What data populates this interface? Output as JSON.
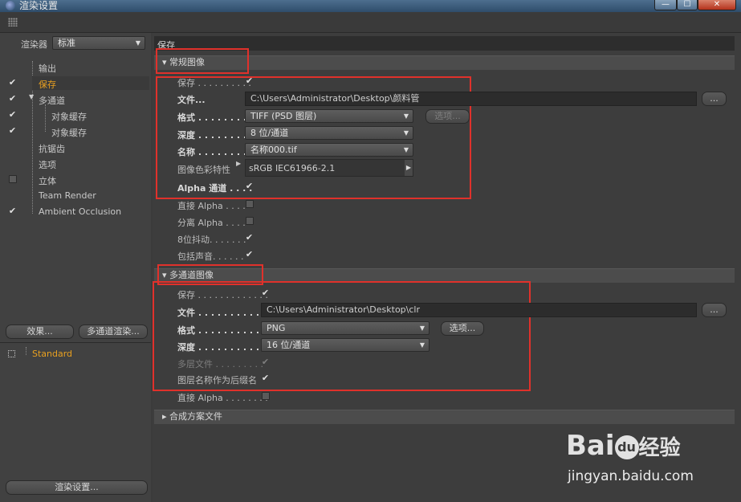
{
  "window": {
    "title": "渲染设置",
    "min": "—",
    "max": "☐",
    "close": "✕"
  },
  "sidebar": {
    "renderer_label": "渲染器",
    "renderer_value": "标准",
    "items": [
      {
        "label": "输出",
        "checked": false
      },
      {
        "label": "保存",
        "checked": true,
        "active": true
      },
      {
        "label": "多通道",
        "checked": true
      },
      {
        "label": "对象缓存",
        "checked": true
      },
      {
        "label": "对象缓存",
        "checked": true
      },
      {
        "label": "抗锯齿",
        "checked": false
      },
      {
        "label": "选项",
        "checked": false
      },
      {
        "label": "立体",
        "checked": false
      },
      {
        "label": "Team Render",
        "checked": false
      },
      {
        "label": "Ambient Occlusion",
        "checked": true
      }
    ],
    "effects_btn": "效果...",
    "multipass_btn": "多通道渲染...",
    "preset": "Standard",
    "render_settings_btn": "渲染设置..."
  },
  "header": {
    "title": "保存"
  },
  "regular": {
    "section_title": "常规图像",
    "save_label": "保存 . . . . . . . . . .",
    "file_label": "文件...",
    "file_value": "C:\\Users\\Administrator\\Desktop\\颜料管",
    "file_btn": "...",
    "format_label": "格式 . . . . . . . . .",
    "format_value": "TIFF (PSD 图层)",
    "options_btn": "选项...",
    "depth_label": "深度 . . . . . . . . .",
    "depth_value": "8 位/通道",
    "name_label": "名称 . . . . . . . . .",
    "name_value": "名称000.tif",
    "profile_label": "图像色彩特性",
    "profile_value": "sRGB IEC61966-2.1",
    "alpha_label": "Alpha 通道 . . . .",
    "straight_alpha_label": "直接 Alpha . . . .",
    "separate_alpha_label": "分离 Alpha . . . .",
    "dither_label": "8位抖动. . . . . . .",
    "sound_label": "包括声音. . . . . ."
  },
  "multipass": {
    "section_title": "多通道图像",
    "save_label": "保存 . . . . . . . . . . . . .",
    "file_label": "文件 . . . . . . . . . . . . .",
    "file_value": "C:\\Users\\Administrator\\Desktop\\clr",
    "file_btn": "...",
    "format_label": "格式 . . . . . . . . . . . . .",
    "format_value": "PNG",
    "options_btn": "选项...",
    "depth_label": "深度 . . . . . . . . . . . . .",
    "depth_value": "16 位/通道",
    "layers_label": "多层文件 . . . . . . . . .",
    "layername_label": "图层名称作为后缀名",
    "straight_alpha_label": "直接 Alpha . . . . . . . ."
  },
  "composite": {
    "section_title": "合成方案文件"
  },
  "watermark": {
    "text": "jingyan.baidu.com",
    "brand_a": "Bai",
    "brand_b": "du",
    "brand_c": "经验"
  }
}
